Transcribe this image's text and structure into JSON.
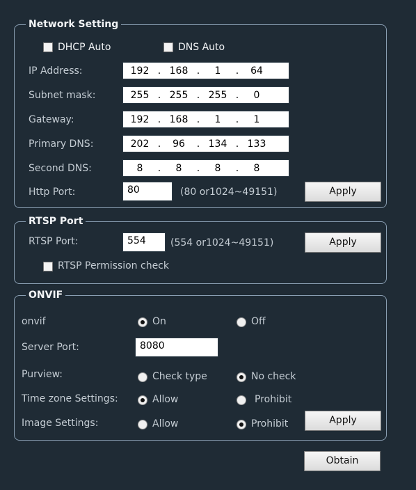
{
  "network": {
    "title": "Network Setting",
    "dhcp_label": "DHCP Auto",
    "dns_label": "DNS Auto",
    "ip_label": "IP Address:",
    "ip": [
      "192",
      "168",
      "1",
      "64"
    ],
    "subnet_label": "Subnet mask:",
    "subnet": [
      "255",
      "255",
      "255",
      "0"
    ],
    "gateway_label": "Gateway:",
    "gateway": [
      "192",
      "168",
      "1",
      "1"
    ],
    "primary_dns_label": "Primary DNS:",
    "primary_dns": [
      "202",
      "96",
      "134",
      "133"
    ],
    "second_dns_label": "Second DNS:",
    "second_dns": [
      "8",
      "8",
      "8",
      "8"
    ],
    "http_port_label": "Http Port:",
    "http_port": "80",
    "http_port_hint": "(80 or1024~49151)",
    "apply_label": "Apply"
  },
  "rtsp": {
    "title": "RTSP Port",
    "port_label": "RTSP Port:",
    "port": "554",
    "port_hint": "(554 or1024~49151)",
    "permission_label": "RTSP Permission check",
    "apply_label": "Apply"
  },
  "onvif": {
    "title": "ONVIF",
    "onvif_label": "onvif",
    "on_label": "On",
    "off_label": "Off",
    "server_port_label": "Server Port:",
    "server_port": "8080",
    "purview_label": "Purview:",
    "check_type_label": "Check type",
    "no_check_label": "No check",
    "timezone_label": "Time zone Settings:",
    "allow_label": "Allow",
    "prohibit_label": "Prohibit",
    "image_label": "Image Settings:",
    "apply_label": "Apply"
  },
  "obtain_label": "Obtain"
}
